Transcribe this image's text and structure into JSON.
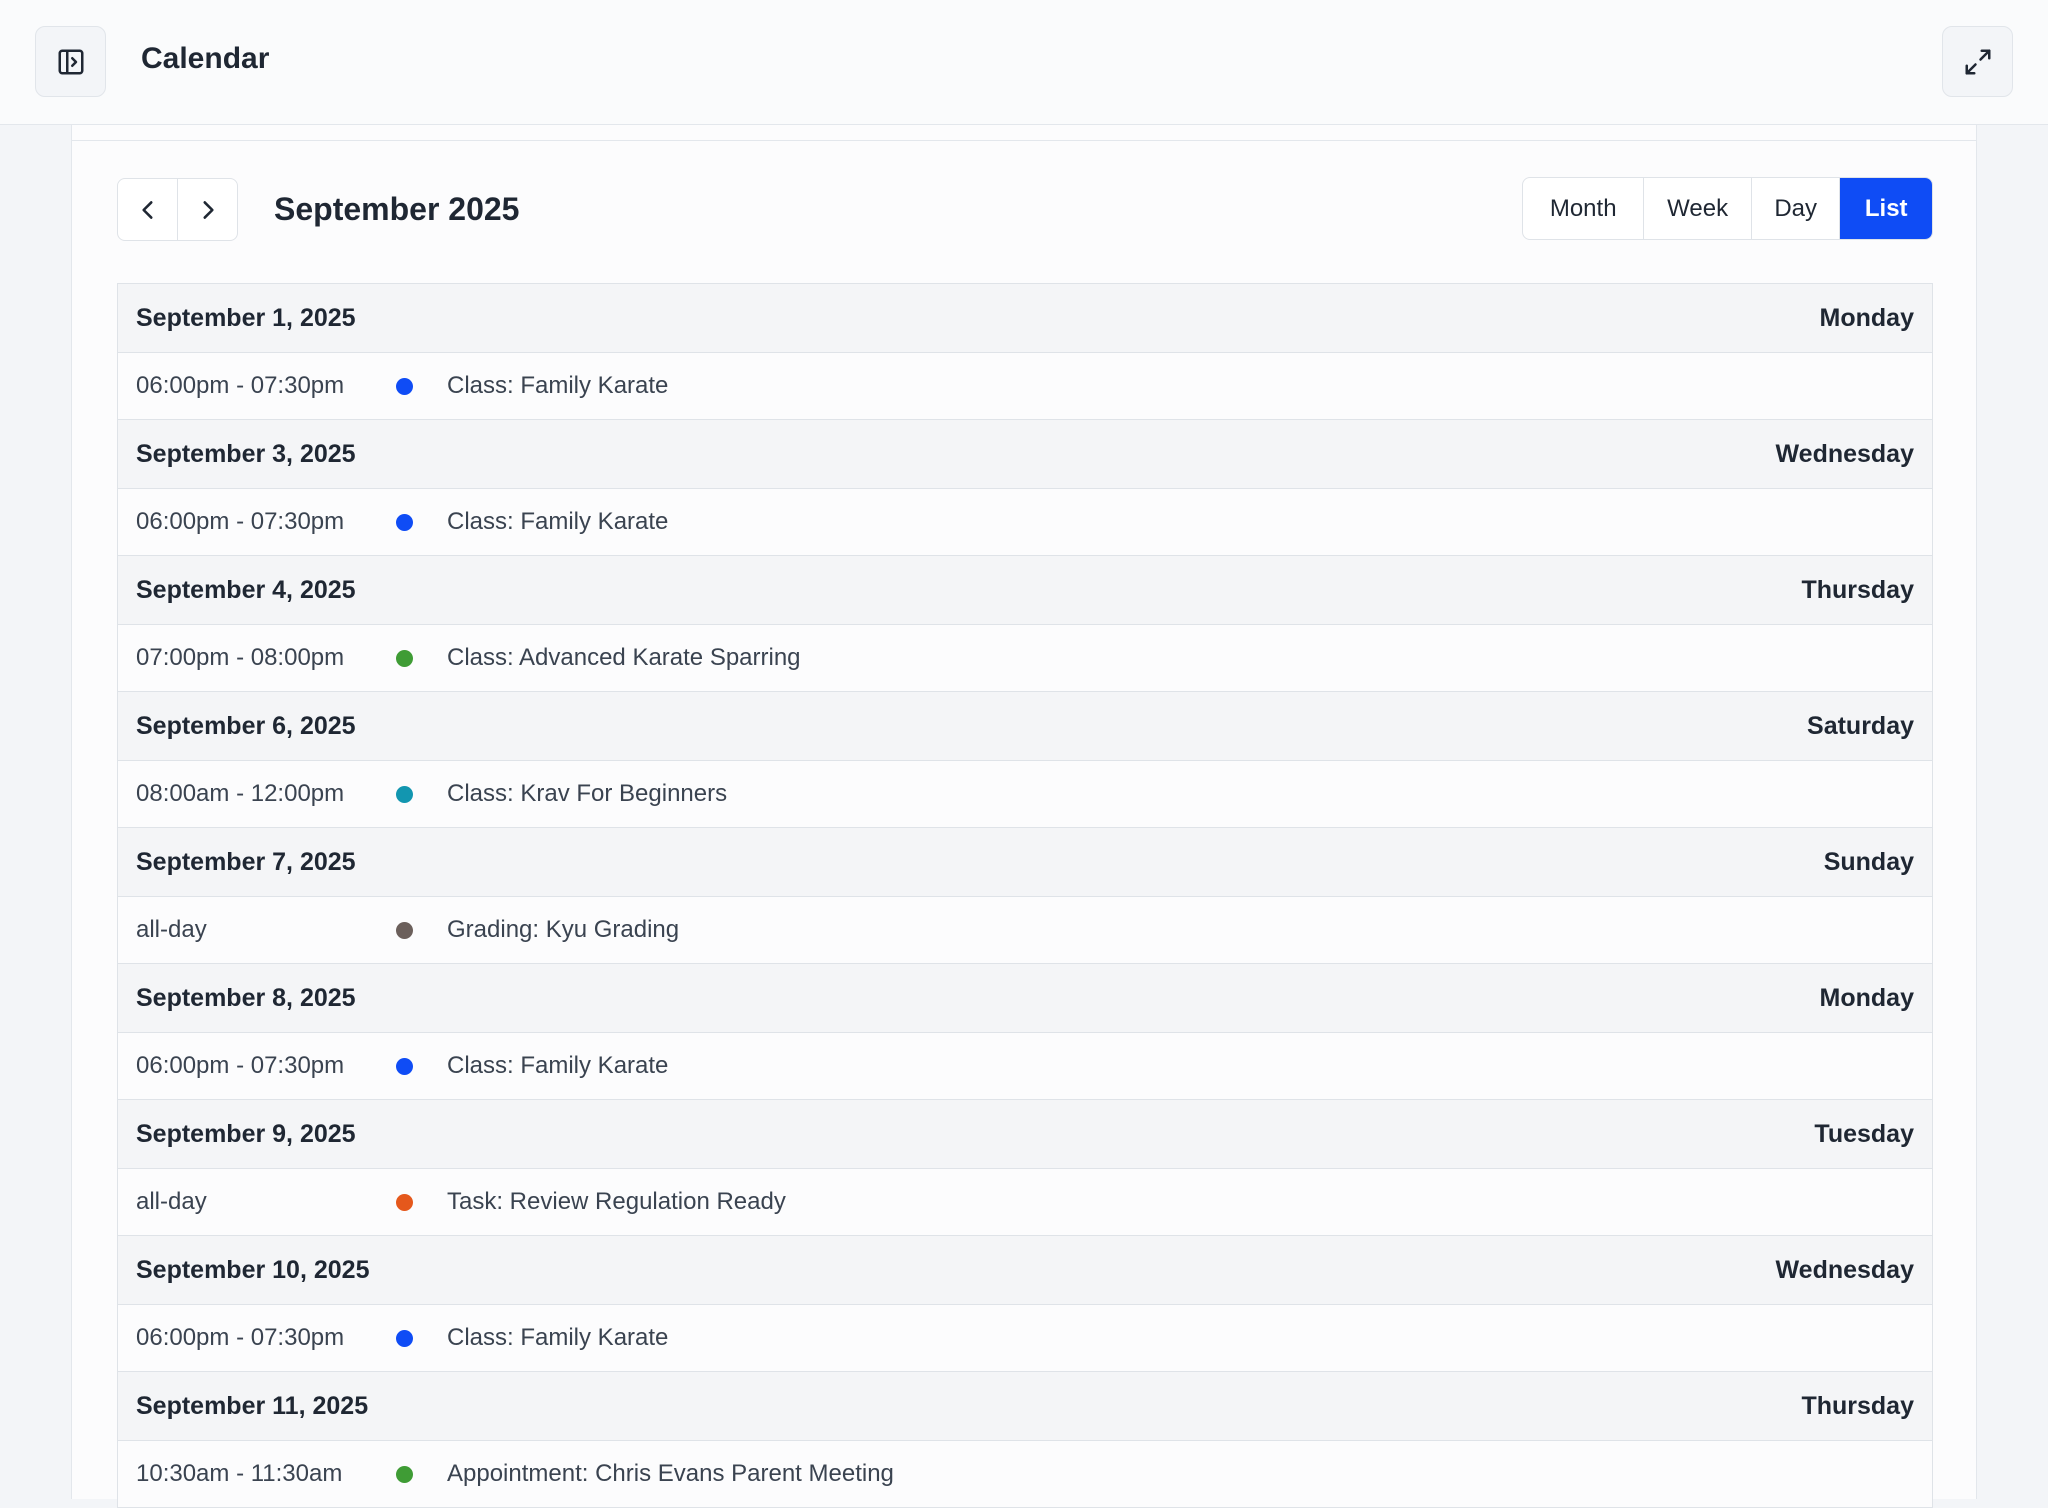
{
  "header": {
    "title": "Calendar"
  },
  "toolbar": {
    "month_title": "September 2025",
    "views": [
      {
        "label": "Month",
        "active": false
      },
      {
        "label": "Week",
        "active": false
      },
      {
        "label": "Day",
        "active": false
      },
      {
        "label": "List",
        "active": true
      }
    ]
  },
  "colors": {
    "accent": "#0f4cf5",
    "blue": "#0f4cf5",
    "green": "#3f9c35",
    "teal": "#1296b0",
    "gray": "#6b5f5b",
    "orange": "#e5581c"
  },
  "days": [
    {
      "date": "September 1, 2025",
      "weekday": "Monday",
      "events": [
        {
          "time": "06:00pm - 07:30pm",
          "title": "Class: Family Karate",
          "color": "#0f4cf5"
        }
      ]
    },
    {
      "date": "September 3, 2025",
      "weekday": "Wednesday",
      "events": [
        {
          "time": "06:00pm - 07:30pm",
          "title": "Class: Family Karate",
          "color": "#0f4cf5"
        }
      ]
    },
    {
      "date": "September 4, 2025",
      "weekday": "Thursday",
      "events": [
        {
          "time": "07:00pm - 08:00pm",
          "title": "Class: Advanced Karate Sparring",
          "color": "#3f9c35"
        }
      ]
    },
    {
      "date": "September 6, 2025",
      "weekday": "Saturday",
      "events": [
        {
          "time": "08:00am - 12:00pm",
          "title": "Class: Krav For Beginners",
          "color": "#1296b0"
        }
      ]
    },
    {
      "date": "September 7, 2025",
      "weekday": "Sunday",
      "events": [
        {
          "time": "all-day",
          "title": "Grading: Kyu Grading",
          "color": "#6b5f5b"
        }
      ]
    },
    {
      "date": "September 8, 2025",
      "weekday": "Monday",
      "events": [
        {
          "time": "06:00pm - 07:30pm",
          "title": "Class: Family Karate",
          "color": "#0f4cf5"
        }
      ]
    },
    {
      "date": "September 9, 2025",
      "weekday": "Tuesday",
      "events": [
        {
          "time": "all-day",
          "title": "Task: Review Regulation Ready",
          "color": "#e5581c"
        }
      ]
    },
    {
      "date": "September 10, 2025",
      "weekday": "Wednesday",
      "events": [
        {
          "time": "06:00pm - 07:30pm",
          "title": "Class: Family Karate",
          "color": "#0f4cf5"
        }
      ]
    },
    {
      "date": "September 11, 2025",
      "weekday": "Thursday",
      "events": [
        {
          "time": "10:30am - 11:30am",
          "title": "Appointment: Chris Evans Parent Meeting",
          "color": "#3f9c35"
        }
      ]
    }
  ]
}
